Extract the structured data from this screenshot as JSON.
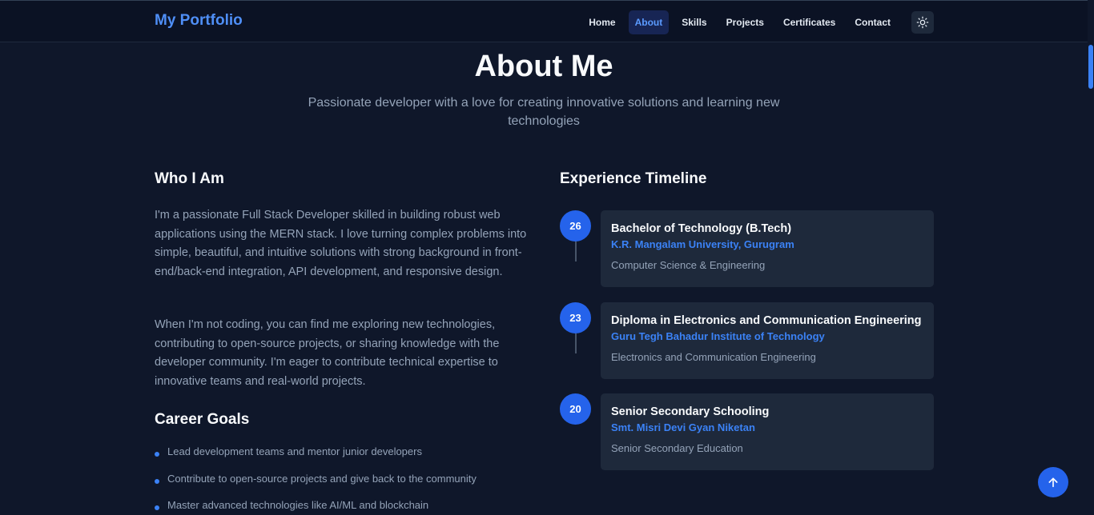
{
  "nav": {
    "brand": "My Portfolio",
    "items": [
      {
        "label": "Home",
        "active": false
      },
      {
        "label": "About",
        "active": true
      },
      {
        "label": "Skills",
        "active": false
      },
      {
        "label": "Projects",
        "active": false
      },
      {
        "label": "Certificates",
        "active": false
      },
      {
        "label": "Contact",
        "active": false
      }
    ],
    "theme_icon": "sun-icon"
  },
  "hero": {
    "title": "About Me",
    "subtitle": "Passionate developer with a love for creating innovative solutions and learning new technologies"
  },
  "who": {
    "title": "Who I Am",
    "p1": "I'm a passionate Full Stack Developer skilled in building robust web applications using the MERN stack. I love turning complex problems into simple, beautiful, and intuitive solutions with strong background in front-end/back-end integration, API development, and responsive design.",
    "p2": "When I'm not coding, you can find me exploring new technologies, contributing to open-source projects, or sharing knowledge with the developer community. I'm eager to contribute technical expertise to innovative teams and real-world projects."
  },
  "goals": {
    "title": "Career Goals",
    "items": [
      "Lead development teams and mentor junior developers",
      "Contribute to open-source projects and give back to the community",
      "Master advanced technologies like AI/ML and blockchain"
    ]
  },
  "timeline": {
    "title": "Experience Timeline",
    "items": [
      {
        "year": "26",
        "title": "Bachelor of Technology (B.Tech)",
        "institution": "K.R. Mangalam University, Gurugram",
        "detail": "Computer Science & Engineering"
      },
      {
        "year": "23",
        "title": "Diploma in Electronics and Communication Engineering",
        "institution": "Guru Tegh Bahadur Institute of Technology",
        "detail": "Electronics and Communication Engineering"
      },
      {
        "year": "20",
        "title": "Senior Secondary Schooling",
        "institution": "Smt. Misri Devi Gyan Niketan",
        "detail": "Senior Secondary Education"
      }
    ]
  },
  "scroll_top_icon": "arrow-up-icon",
  "colors": {
    "accent": "#3b82f6",
    "background": "#0f172a",
    "card": "#1e293b"
  }
}
